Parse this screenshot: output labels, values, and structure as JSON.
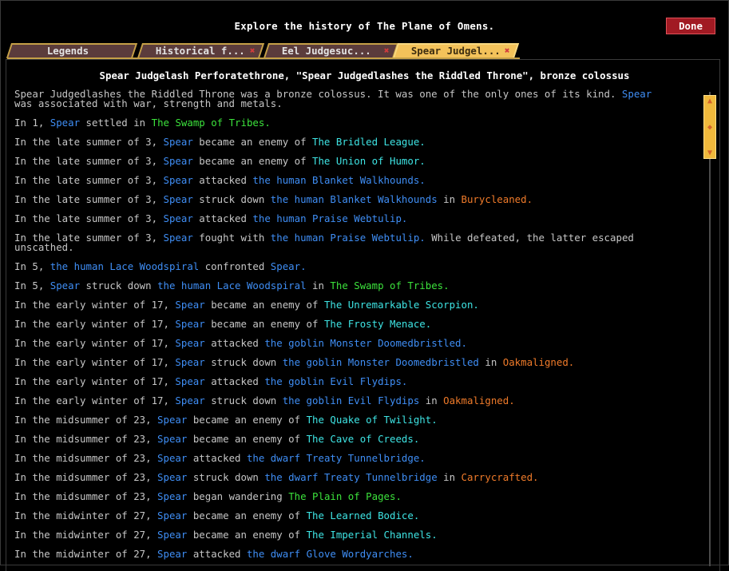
{
  "header": {
    "title": "Explore the history of The Plane of Omens."
  },
  "done_button": {
    "label": "Done"
  },
  "tabs": [
    {
      "label": "Legends",
      "closable": false,
      "active": false
    },
    {
      "label": "Historical f...",
      "closable": true,
      "active": false
    },
    {
      "label": "Eel Judgesuc...",
      "closable": true,
      "active": false
    },
    {
      "label": "Spear Judgel...",
      "closable": true,
      "active": true
    }
  ],
  "entity": {
    "title": "Spear Judgelash Perforatethrone, \"Spear Judgedlashes the Riddled Throne\", bronze colossus",
    "description": [
      {
        "t": "Spear Judgedlashes the Riddled Throne was a bronze colossus. It was one of the only ones of its kind. "
      },
      {
        "t": "Spear",
        "c": "blue"
      },
      {
        "t": "\nwas associated with war, strength and metals."
      }
    ]
  },
  "colors": {
    "historical_figure": "#3f8ef5",
    "civilization": "#3ee4e4",
    "region": "#3ce23c",
    "site": "#f07b2a",
    "text": "#c6c6c6",
    "accent_tab": "#f3c25a",
    "done_button": "#a11a23"
  },
  "events": [
    [
      {
        "t": "In 1, "
      },
      {
        "t": "Spear",
        "c": "blue"
      },
      {
        "t": " settled in "
      },
      {
        "t": "The Swamp of Tribes.",
        "c": "green"
      }
    ],
    [
      {
        "t": "In the late summer of 3, "
      },
      {
        "t": "Spear",
        "c": "blue"
      },
      {
        "t": " became an enemy of "
      },
      {
        "t": "The Bridled League.",
        "c": "cyan"
      }
    ],
    [
      {
        "t": "In the late summer of 3, "
      },
      {
        "t": "Spear",
        "c": "blue"
      },
      {
        "t": " became an enemy of "
      },
      {
        "t": "The Union of Humor.",
        "c": "cyan"
      }
    ],
    [
      {
        "t": "In the late summer of 3, "
      },
      {
        "t": "Spear",
        "c": "blue"
      },
      {
        "t": " attacked "
      },
      {
        "t": "the human Blanket Walkhounds.",
        "c": "blue"
      }
    ],
    [
      {
        "t": "In the late summer of 3, "
      },
      {
        "t": "Spear",
        "c": "blue"
      },
      {
        "t": " struck down "
      },
      {
        "t": "the human Blanket Walkhounds",
        "c": "blue"
      },
      {
        "t": " in "
      },
      {
        "t": "Burycleaned.",
        "c": "orange"
      }
    ],
    [
      {
        "t": "In the late summer of 3, "
      },
      {
        "t": "Spear",
        "c": "blue"
      },
      {
        "t": " attacked "
      },
      {
        "t": "the human Praise Webtulip.",
        "c": "blue"
      }
    ],
    [
      {
        "t": "In the late summer of 3, "
      },
      {
        "t": "Spear",
        "c": "blue"
      },
      {
        "t": " fought with "
      },
      {
        "t": "the human Praise Webtulip.",
        "c": "blue"
      },
      {
        "t": " While defeated, the latter escaped\nunscathed."
      }
    ],
    [
      {
        "t": "In 5, "
      },
      {
        "t": "the human Lace Woodspiral",
        "c": "blue"
      },
      {
        "t": " confronted "
      },
      {
        "t": "Spear.",
        "c": "blue"
      }
    ],
    [
      {
        "t": "In 5, "
      },
      {
        "t": "Spear",
        "c": "blue"
      },
      {
        "t": " struck down "
      },
      {
        "t": "the human Lace Woodspiral",
        "c": "blue"
      },
      {
        "t": " in "
      },
      {
        "t": "The Swamp of Tribes.",
        "c": "green"
      }
    ],
    [
      {
        "t": "In the early winter of 17, "
      },
      {
        "t": "Spear",
        "c": "blue"
      },
      {
        "t": " became an enemy of "
      },
      {
        "t": "The Unremarkable Scorpion.",
        "c": "cyan"
      }
    ],
    [
      {
        "t": "In the early winter of 17, "
      },
      {
        "t": "Spear",
        "c": "blue"
      },
      {
        "t": " became an enemy of "
      },
      {
        "t": "The Frosty Menace.",
        "c": "cyan"
      }
    ],
    [
      {
        "t": "In the early winter of 17, "
      },
      {
        "t": "Spear",
        "c": "blue"
      },
      {
        "t": " attacked "
      },
      {
        "t": "the goblin Monster Doomedbristled.",
        "c": "blue"
      }
    ],
    [
      {
        "t": "In the early winter of 17, "
      },
      {
        "t": "Spear",
        "c": "blue"
      },
      {
        "t": " struck down "
      },
      {
        "t": "the goblin Monster Doomedbristled",
        "c": "blue"
      },
      {
        "t": " in "
      },
      {
        "t": "Oakmaligned.",
        "c": "orange"
      }
    ],
    [
      {
        "t": "In the early winter of 17, "
      },
      {
        "t": "Spear",
        "c": "blue"
      },
      {
        "t": " attacked "
      },
      {
        "t": "the goblin Evil Flydips.",
        "c": "blue"
      }
    ],
    [
      {
        "t": "In the early winter of 17, "
      },
      {
        "t": "Spear",
        "c": "blue"
      },
      {
        "t": " struck down "
      },
      {
        "t": "the goblin Evil Flydips",
        "c": "blue"
      },
      {
        "t": " in "
      },
      {
        "t": "Oakmaligned.",
        "c": "orange"
      }
    ],
    [
      {
        "t": "In the midsummer of 23, "
      },
      {
        "t": "Spear",
        "c": "blue"
      },
      {
        "t": " became an enemy of "
      },
      {
        "t": "The Quake of Twilight.",
        "c": "cyan"
      }
    ],
    [
      {
        "t": "In the midsummer of 23, "
      },
      {
        "t": "Spear",
        "c": "blue"
      },
      {
        "t": " became an enemy of "
      },
      {
        "t": "The Cave of Creeds.",
        "c": "cyan"
      }
    ],
    [
      {
        "t": "In the midsummer of 23, "
      },
      {
        "t": "Spear",
        "c": "blue"
      },
      {
        "t": " attacked "
      },
      {
        "t": "the dwarf Treaty Tunnelbridge.",
        "c": "blue"
      }
    ],
    [
      {
        "t": "In the midsummer of 23, "
      },
      {
        "t": "Spear",
        "c": "blue"
      },
      {
        "t": " struck down "
      },
      {
        "t": "the dwarf Treaty Tunnelbridge",
        "c": "blue"
      },
      {
        "t": " in "
      },
      {
        "t": "Carrycrafted.",
        "c": "orange"
      }
    ],
    [
      {
        "t": "In the midsummer of 23, "
      },
      {
        "t": "Spear",
        "c": "blue"
      },
      {
        "t": " began wandering "
      },
      {
        "t": "The Plain of Pages.",
        "c": "green"
      }
    ],
    [
      {
        "t": "In the midwinter of 27, "
      },
      {
        "t": "Spear",
        "c": "blue"
      },
      {
        "t": " became an enemy of "
      },
      {
        "t": "The Learned Bodice.",
        "c": "cyan"
      }
    ],
    [
      {
        "t": "In the midwinter of 27, "
      },
      {
        "t": "Spear",
        "c": "blue"
      },
      {
        "t": " became an enemy of "
      },
      {
        "t": "The Imperial Channels.",
        "c": "cyan"
      }
    ],
    [
      {
        "t": "In the midwinter of 27, "
      },
      {
        "t": "Spear",
        "c": "blue"
      },
      {
        "t": " attacked "
      },
      {
        "t": "the dwarf Glove Wordyarches.",
        "c": "blue"
      }
    ]
  ],
  "scrollbar": {
    "up_icon": "arrow-up-icon",
    "down_icon": "arrow-down-icon",
    "grip_icon": "diamond-grip-icon"
  }
}
